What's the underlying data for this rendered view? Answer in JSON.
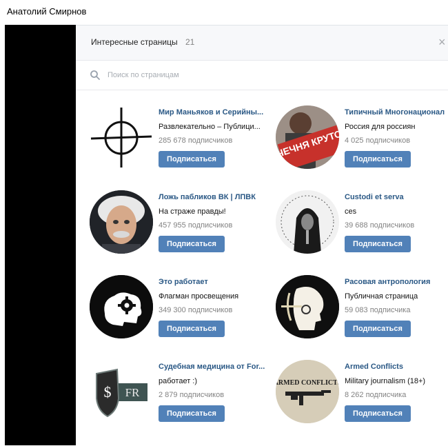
{
  "user": {
    "name": "Анатолий Смирнов"
  },
  "modal": {
    "title": "Интересные страницы",
    "count": "21",
    "close_label": "×",
    "search_placeholder": "Поиск по страницам"
  },
  "subscribe_label": "Подписаться",
  "pages": [
    {
      "name": "Мир Маньяков и Серийны...",
      "desc": "Развлекательно – Публици...",
      "subs": "285 678 подписчиков",
      "avatar": "crosshair-avatar"
    },
    {
      "name": "Типичный Многонационал",
      "desc": "Россия для россиян",
      "subs": "4 025 подписчиков",
      "avatar": "stamp-avatar",
      "avatar_text": "ЧЕЧНЯ КРУТО"
    },
    {
      "name": "Ложь пабликов ВК | ЛПВК",
      "desc": "На страже правды!",
      "subs": "457 955 подписчиков",
      "avatar": "einstein-avatar"
    },
    {
      "name": "Custodi et serva",
      "desc": "ces",
      "subs": "39 688 подписчиков",
      "avatar": "hooded-figure-avatar"
    },
    {
      "name": "Это работает",
      "desc": "Флагман просвещения",
      "subs": "349 300 подписчиков",
      "avatar": "gear-head-avatar"
    },
    {
      "name": "Расовая антропология",
      "desc": "Публичная страница",
      "subs": "59 083 подписчика",
      "avatar": "profile-head-avatar"
    },
    {
      "name": "Судебная медицина от For...",
      "desc": "работает :)",
      "subs": "2 879 подписчиков",
      "avatar": "shield-fr-avatar",
      "avatar_text": "FR"
    },
    {
      "name": "Armed Conflicts",
      "desc": "Military journalism (18+)",
      "subs": "8 262 подписчика",
      "avatar": "armed-conflicts-avatar",
      "avatar_text": "ARMED CONFLICTS"
    }
  ]
}
